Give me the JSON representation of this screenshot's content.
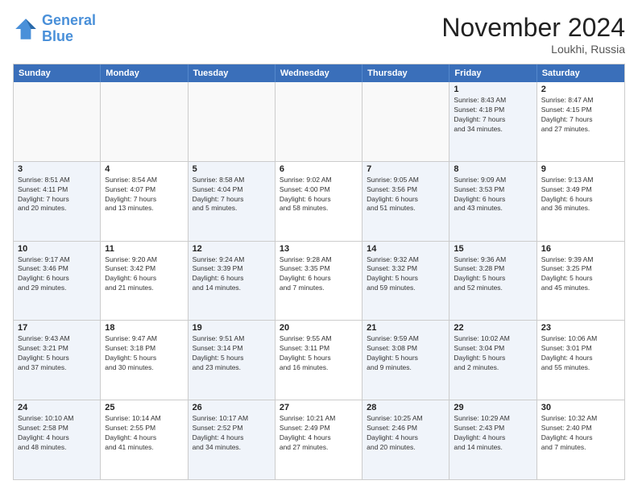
{
  "logo": {
    "line1": "General",
    "line2": "Blue"
  },
  "title": "November 2024",
  "location": "Loukhi, Russia",
  "header_days": [
    "Sunday",
    "Monday",
    "Tuesday",
    "Wednesday",
    "Thursday",
    "Friday",
    "Saturday"
  ],
  "rows": [
    [
      {
        "day": "",
        "info": "",
        "empty": true
      },
      {
        "day": "",
        "info": "",
        "empty": true
      },
      {
        "day": "",
        "info": "",
        "empty": true
      },
      {
        "day": "",
        "info": "",
        "empty": true
      },
      {
        "day": "",
        "info": "",
        "empty": true
      },
      {
        "day": "1",
        "info": "Sunrise: 8:43 AM\nSunset: 4:18 PM\nDaylight: 7 hours\nand 34 minutes.",
        "shaded": true
      },
      {
        "day": "2",
        "info": "Sunrise: 8:47 AM\nSunset: 4:15 PM\nDaylight: 7 hours\nand 27 minutes.",
        "shaded": false
      }
    ],
    [
      {
        "day": "3",
        "info": "Sunrise: 8:51 AM\nSunset: 4:11 PM\nDaylight: 7 hours\nand 20 minutes.",
        "shaded": true
      },
      {
        "day": "4",
        "info": "Sunrise: 8:54 AM\nSunset: 4:07 PM\nDaylight: 7 hours\nand 13 minutes.",
        "shaded": false
      },
      {
        "day": "5",
        "info": "Sunrise: 8:58 AM\nSunset: 4:04 PM\nDaylight: 7 hours\nand 5 minutes.",
        "shaded": true
      },
      {
        "day": "6",
        "info": "Sunrise: 9:02 AM\nSunset: 4:00 PM\nDaylight: 6 hours\nand 58 minutes.",
        "shaded": false
      },
      {
        "day": "7",
        "info": "Sunrise: 9:05 AM\nSunset: 3:56 PM\nDaylight: 6 hours\nand 51 minutes.",
        "shaded": true
      },
      {
        "day": "8",
        "info": "Sunrise: 9:09 AM\nSunset: 3:53 PM\nDaylight: 6 hours\nand 43 minutes.",
        "shaded": true
      },
      {
        "day": "9",
        "info": "Sunrise: 9:13 AM\nSunset: 3:49 PM\nDaylight: 6 hours\nand 36 minutes.",
        "shaded": false
      }
    ],
    [
      {
        "day": "10",
        "info": "Sunrise: 9:17 AM\nSunset: 3:46 PM\nDaylight: 6 hours\nand 29 minutes.",
        "shaded": true
      },
      {
        "day": "11",
        "info": "Sunrise: 9:20 AM\nSunset: 3:42 PM\nDaylight: 6 hours\nand 21 minutes.",
        "shaded": false
      },
      {
        "day": "12",
        "info": "Sunrise: 9:24 AM\nSunset: 3:39 PM\nDaylight: 6 hours\nand 14 minutes.",
        "shaded": true
      },
      {
        "day": "13",
        "info": "Sunrise: 9:28 AM\nSunset: 3:35 PM\nDaylight: 6 hours\nand 7 minutes.",
        "shaded": false
      },
      {
        "day": "14",
        "info": "Sunrise: 9:32 AM\nSunset: 3:32 PM\nDaylight: 5 hours\nand 59 minutes.",
        "shaded": true
      },
      {
        "day": "15",
        "info": "Sunrise: 9:36 AM\nSunset: 3:28 PM\nDaylight: 5 hours\nand 52 minutes.",
        "shaded": true
      },
      {
        "day": "16",
        "info": "Sunrise: 9:39 AM\nSunset: 3:25 PM\nDaylight: 5 hours\nand 45 minutes.",
        "shaded": false
      }
    ],
    [
      {
        "day": "17",
        "info": "Sunrise: 9:43 AM\nSunset: 3:21 PM\nDaylight: 5 hours\nand 37 minutes.",
        "shaded": true
      },
      {
        "day": "18",
        "info": "Sunrise: 9:47 AM\nSunset: 3:18 PM\nDaylight: 5 hours\nand 30 minutes.",
        "shaded": false
      },
      {
        "day": "19",
        "info": "Sunrise: 9:51 AM\nSunset: 3:14 PM\nDaylight: 5 hours\nand 23 minutes.",
        "shaded": true
      },
      {
        "day": "20",
        "info": "Sunrise: 9:55 AM\nSunset: 3:11 PM\nDaylight: 5 hours\nand 16 minutes.",
        "shaded": false
      },
      {
        "day": "21",
        "info": "Sunrise: 9:59 AM\nSunset: 3:08 PM\nDaylight: 5 hours\nand 9 minutes.",
        "shaded": true
      },
      {
        "day": "22",
        "info": "Sunrise: 10:02 AM\nSunset: 3:04 PM\nDaylight: 5 hours\nand 2 minutes.",
        "shaded": true
      },
      {
        "day": "23",
        "info": "Sunrise: 10:06 AM\nSunset: 3:01 PM\nDaylight: 4 hours\nand 55 minutes.",
        "shaded": false
      }
    ],
    [
      {
        "day": "24",
        "info": "Sunrise: 10:10 AM\nSunset: 2:58 PM\nDaylight: 4 hours\nand 48 minutes.",
        "shaded": true
      },
      {
        "day": "25",
        "info": "Sunrise: 10:14 AM\nSunset: 2:55 PM\nDaylight: 4 hours\nand 41 minutes.",
        "shaded": false
      },
      {
        "day": "26",
        "info": "Sunrise: 10:17 AM\nSunset: 2:52 PM\nDaylight: 4 hours\nand 34 minutes.",
        "shaded": true
      },
      {
        "day": "27",
        "info": "Sunrise: 10:21 AM\nSunset: 2:49 PM\nDaylight: 4 hours\nand 27 minutes.",
        "shaded": false
      },
      {
        "day": "28",
        "info": "Sunrise: 10:25 AM\nSunset: 2:46 PM\nDaylight: 4 hours\nand 20 minutes.",
        "shaded": true
      },
      {
        "day": "29",
        "info": "Sunrise: 10:29 AM\nSunset: 2:43 PM\nDaylight: 4 hours\nand 14 minutes.",
        "shaded": true
      },
      {
        "day": "30",
        "info": "Sunrise: 10:32 AM\nSunset: 2:40 PM\nDaylight: 4 hours\nand 7 minutes.",
        "shaded": false
      }
    ]
  ]
}
